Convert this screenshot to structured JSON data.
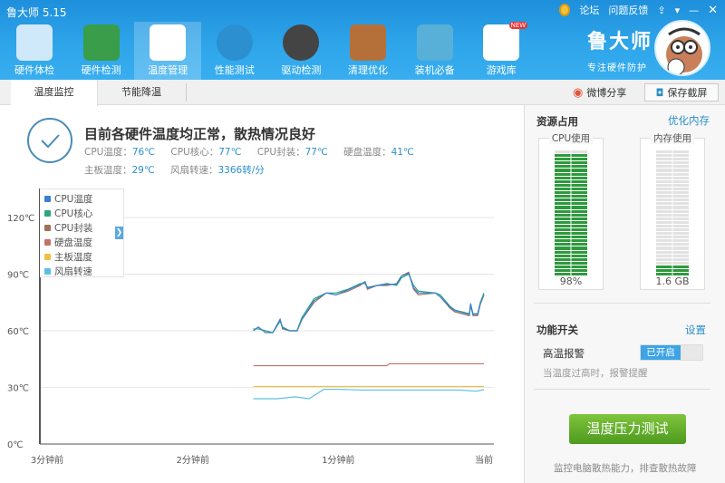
{
  "app": {
    "title": "鲁大师 5.15",
    "forum": "论坛",
    "feedback": "问题反馈"
  },
  "nav": [
    {
      "label": "硬件体检",
      "icon": "monitor-icon"
    },
    {
      "label": "硬件检测",
      "icon": "graphics-card-icon"
    },
    {
      "label": "温度管理",
      "icon": "thermometer-icon",
      "active": true
    },
    {
      "label": "性能测试",
      "icon": "speedometer-icon"
    },
    {
      "label": "驱动检测",
      "icon": "driver-gear-icon"
    },
    {
      "label": "清理优化",
      "icon": "broom-icon"
    },
    {
      "label": "装机必备",
      "icon": "cube-icon"
    },
    {
      "label": "游戏库",
      "icon": "gamepad-icon",
      "badge": "NEW"
    }
  ],
  "brand": {
    "name": "鲁大师",
    "slogan": "专注硬件防护"
  },
  "tabs": [
    {
      "label": "温度监控",
      "active": true
    },
    {
      "label": "节能降温"
    }
  ],
  "toolbar": {
    "share": "微博分享",
    "save": "保存截屏"
  },
  "status": {
    "headline": "目前各硬件温度均正常，散热情况良好",
    "metrics": [
      {
        "label": "CPU温度：",
        "value": "76℃"
      },
      {
        "label": "CPU核心：",
        "value": "77℃"
      },
      {
        "label": "CPU封装：",
        "value": "77℃"
      },
      {
        "label": "硬盘温度：",
        "value": "41℃"
      },
      {
        "label": "主板温度：",
        "value": "29℃"
      },
      {
        "label": "风扇转速：",
        "value": "3366转/分"
      }
    ]
  },
  "chart_data": {
    "type": "line",
    "ylabel": "",
    "yticks": [
      "0℃",
      "30℃",
      "60℃",
      "90℃",
      "120℃"
    ],
    "ylim": [
      0,
      120
    ],
    "xlim": [
      -180,
      0
    ],
    "xticks": [
      "3分钟前",
      "2分钟前",
      "1分钟前",
      "当前"
    ],
    "x_unit": "seconds",
    "legend": [
      "CPU温度",
      "CPU核心",
      "CPU封装",
      "硬盘温度",
      "主板温度",
      "风扇转速"
    ],
    "series": [
      {
        "name": "CPU温度",
        "color": "#3a7fd5",
        "x": [
          -95,
          -93,
          -90,
          -87,
          -84,
          -83,
          -80,
          -77,
          -75,
          -70,
          -65,
          -61,
          -56,
          -51,
          -49,
          -48,
          -44,
          -40,
          -36,
          -34,
          -31,
          -29,
          -27,
          -20,
          -18,
          -14,
          -12,
          -6,
          -5.5,
          -4.5,
          -2.6,
          -1.5,
          0
        ],
        "y": [
          60,
          62,
          59,
          59,
          66,
          61.5,
          60,
          60,
          66,
          76,
          80,
          79,
          81.7,
          84.6,
          86,
          82.7,
          84,
          84.6,
          84.6,
          89,
          90.4,
          82.7,
          80,
          80,
          78,
          72.6,
          70.7,
          68.7,
          74.5,
          68.7,
          68.7,
          74.5,
          79
        ]
      },
      {
        "name": "CPU核心",
        "color": "#2ea67a",
        "x": [
          -95,
          -93,
          -90,
          -87,
          -84,
          -83,
          -80,
          -77,
          -75,
          -70,
          -65,
          -61,
          -56,
          -51,
          -49,
          -48,
          -44,
          -40,
          -36,
          -34,
          -31,
          -29,
          -27,
          -20,
          -18,
          -14,
          -12,
          -6,
          -5.5,
          -4.5,
          -2.6,
          -1.5,
          0
        ],
        "y": [
          61,
          61,
          60,
          59,
          65,
          62,
          60,
          60,
          67,
          77,
          80,
          80,
          82,
          85,
          85,
          83,
          84,
          85,
          84,
          88,
          90,
          84,
          81,
          80,
          79,
          73,
          71,
          69,
          73,
          69,
          69,
          75,
          80
        ]
      },
      {
        "name": "CPU封装",
        "color": "#a0705a",
        "x": [
          -95,
          -93,
          -90,
          -87,
          -84,
          -83,
          -80,
          -77,
          -75,
          -70,
          -65,
          -61,
          -56,
          -51,
          -49,
          -48,
          -44,
          -40,
          -36,
          -34,
          -31,
          -29,
          -27,
          -20,
          -18,
          -14,
          -12,
          -6,
          -5.5,
          -4.5,
          -2.6,
          -1.5,
          0
        ],
        "y": [
          60,
          62,
          59,
          59,
          66,
          61,
          60,
          60,
          66,
          75,
          80,
          79,
          81,
          84,
          86,
          82,
          84,
          84,
          85,
          89,
          91,
          82,
          79,
          80,
          78,
          72,
          70,
          68,
          74,
          68,
          68,
          74,
          79
        ]
      },
      {
        "name": "硬盘温度",
        "color": "#c0736a",
        "x": [
          -95,
          -40,
          -39,
          0
        ],
        "y": [
          41.5,
          41.5,
          42.5,
          42.5
        ]
      },
      {
        "name": "主板温度",
        "color": "#f0c040",
        "x": [
          -95,
          0
        ],
        "y": [
          30.5,
          30.5
        ]
      },
      {
        "name": "风扇转速",
        "color": "#5bc0e0",
        "x": [
          -95,
          -85,
          -78,
          -72,
          -66,
          -60,
          -50,
          -30,
          -10,
          -3,
          0
        ],
        "y": [
          24,
          24,
          25,
          24,
          29,
          29,
          28.6,
          28.6,
          28.6,
          28,
          28.8
        ]
      }
    ]
  },
  "resources": {
    "title": "资源占用",
    "optimize": "优化内存",
    "cpu": {
      "label": "CPU使用",
      "value": "98%",
      "fraction": 0.98
    },
    "memory": {
      "label": "内存使用",
      "value": "1.6 GB",
      "fraction": 0.1
    }
  },
  "features": {
    "title": "功能开关",
    "settings": "设置",
    "alarm_label": "高温报警",
    "alarm_state": "已开启",
    "alarm_desc": "当温度过高时，报警提醒"
  },
  "stress": {
    "button": "温度压力测试",
    "desc": "监控电脑散热能力，排查散热故障"
  }
}
